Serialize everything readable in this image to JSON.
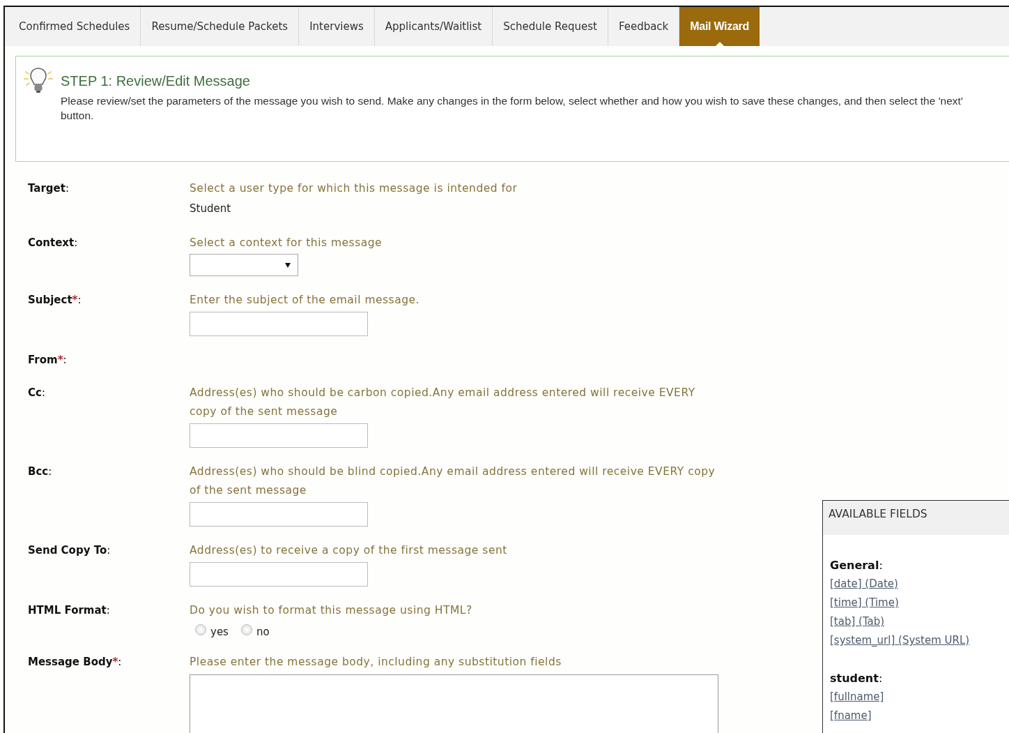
{
  "tabs": [
    {
      "label": "Confirmed Schedules",
      "selected": false
    },
    {
      "label": "Resume/Schedule Packets",
      "selected": false
    },
    {
      "label": "Interviews",
      "selected": false
    },
    {
      "label": "Applicants/Waitlist",
      "selected": false
    },
    {
      "label": "Schedule Request",
      "selected": false
    },
    {
      "label": "Feedback",
      "selected": false
    },
    {
      "label": "Mail Wizard",
      "selected": true
    }
  ],
  "step": {
    "title": "STEP 1: Review/Edit Message",
    "text": "Please review/set the parameters of the message you wish to send. Make any changes in the form below, select whether and how you wish to save these changes, and then select the 'next' button."
  },
  "form": {
    "fields": [
      {
        "label": "Target",
        "colon": ":",
        "kind": "text",
        "hint": "Select a user type for which this message is intended for",
        "value": "Student"
      },
      {
        "label": "Context",
        "colon": ":",
        "kind": "select",
        "hint": "Select a context for this message"
      },
      {
        "label": "Subject",
        "asterisk": "*",
        "colon": ":",
        "kind": "input",
        "hint": "Enter the subject of the email message."
      },
      {
        "label": "From",
        "asterisk": "*",
        "colon": ":",
        "kind": "none"
      },
      {
        "label": "Cc",
        "colon": ":",
        "kind": "input",
        "hint": "Address(es) who should be carbon copied.Any email address entered will receive EVERY copy of the sent message"
      },
      {
        "label": "Bcc",
        "colon": ":",
        "kind": "input",
        "hint": "Address(es) who should be blind copied.Any email address entered will receive EVERY copy of the sent message"
      },
      {
        "label": "Send Copy To",
        "colon": ":",
        "kind": "input",
        "hint": "Address(es) to receive a copy of the first message sent"
      },
      {
        "label": "HTML Format",
        "colon": ":",
        "kind": "radio",
        "hint": "Do you wish to format this message using HTML?",
        "options": [
          {
            "label": "yes",
            "selected": false
          },
          {
            "label": "no",
            "selected": false
          }
        ]
      },
      {
        "label": "Message Body",
        "asterisk": "*",
        "colon": ":",
        "kind": "textarea",
        "hint": "Please enter the message body, including any substitution fields"
      }
    ]
  },
  "available_fields": {
    "title": "AVAILABLE FIELDS",
    "groups": [
      {
        "name": "General",
        "colon": ":",
        "items": [
          "[date] (Date)",
          "[time] (Time)",
          "[tab] (Tab)",
          "[system_url] (System URL)"
        ]
      },
      {
        "name": "student",
        "colon": ":",
        "items": [
          "[fullname]",
          "[fname]"
        ]
      }
    ]
  }
}
